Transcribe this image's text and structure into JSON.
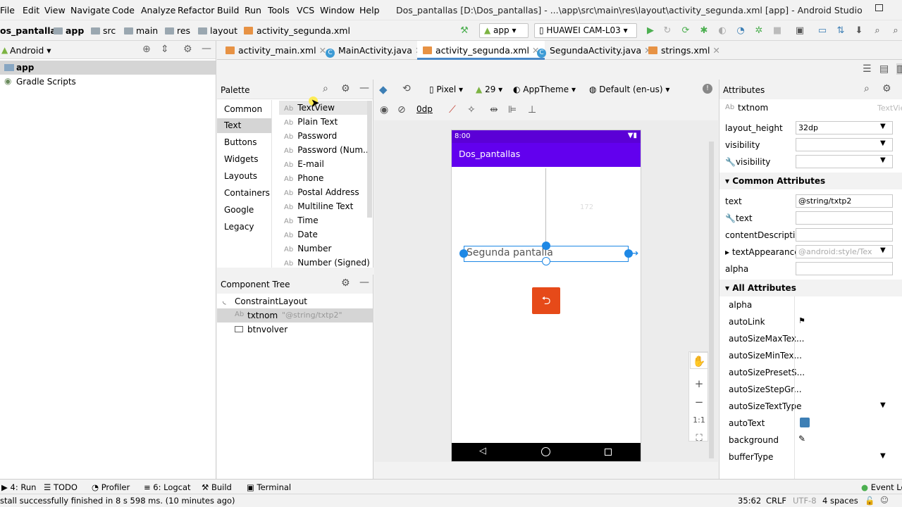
{
  "menu": [
    "File",
    "Edit",
    "View",
    "Navigate",
    "Code",
    "Analyze",
    "Refactor",
    "Build",
    "Run",
    "Tools",
    "VCS",
    "Window",
    "Help"
  ],
  "window_title": "Dos_pantallas [D:\\Dos_pantallas] - ...\\app\\src\\main\\res\\layout\\activity_segunda.xml [app] - Android Studio",
  "breadcrumb": [
    "os_pantallas",
    "app",
    "src",
    "main",
    "res",
    "layout",
    "activity_segunda.xml"
  ],
  "run_config": "app",
  "device": "HUAWEI CAM-L03",
  "project_view": "Android",
  "project_tree": [
    "app",
    "Gradle Scripts"
  ],
  "editor_tabs": [
    {
      "label": "activity_main.xml",
      "kind": "xml"
    },
    {
      "label": "MainActivity.java",
      "kind": "java"
    },
    {
      "label": "activity_segunda.xml",
      "kind": "xml",
      "active": true
    },
    {
      "label": "SegundaActivity.java",
      "kind": "java"
    },
    {
      "label": "strings.xml",
      "kind": "xml"
    }
  ],
  "palette": {
    "title": "Palette",
    "categories": [
      "Common",
      "Text",
      "Buttons",
      "Widgets",
      "Layouts",
      "Containers",
      "Google",
      "Legacy"
    ],
    "selected_category": "Text",
    "items": [
      "TextView",
      "Plain Text",
      "Password",
      "Password (Num...",
      "E-mail",
      "Phone",
      "Postal Address",
      "Multiline Text",
      "Time",
      "Date",
      "Number",
      "Number (Signed)"
    ],
    "item_prefix": "Ab"
  },
  "component_tree": {
    "title": "Component Tree",
    "root": "ConstraintLayout",
    "children": [
      {
        "name": "txtnom",
        "hint": "\"@string/txtp2\""
      },
      {
        "name": "btnvolver",
        "hint": ""
      }
    ]
  },
  "design_toolbar": {
    "device": "Pixel",
    "api": "29",
    "theme": "AppTheme",
    "locale": "Default (en-us)",
    "margin": "0dp"
  },
  "phone": {
    "time": "8:00",
    "app_title": "Dos_pantallas",
    "text": "Segunda pantalla",
    "margin_label": "172",
    "button_color": "#e64a19"
  },
  "zoom_controls": [
    "+",
    "−",
    "1:1"
  ],
  "attributes": {
    "title": "Attributes",
    "component": "txtnom",
    "component_type": "TextView",
    "top_rows": [
      {
        "name": "layout_height",
        "value": "32dp",
        "dropdown": true
      },
      {
        "name": "visibility",
        "value": "",
        "dropdown": true
      },
      {
        "name": "visibility",
        "value": "",
        "dropdown": true,
        "tool": true
      }
    ],
    "common_title": "Common Attributes",
    "common_rows": [
      {
        "name": "text",
        "value": "@string/txtp2"
      },
      {
        "name": "text",
        "value": "",
        "tool": true
      },
      {
        "name": "contentDescripti...",
        "value": ""
      },
      {
        "name": "textAppearance",
        "value": "@android:style/Tex",
        "hint": true,
        "dropdown": true
      },
      {
        "name": "alpha",
        "value": ""
      }
    ],
    "all_title": "All Attributes",
    "all_rows": [
      "alpha",
      "autoLink",
      "autoSizeMaxTex...",
      "autoSizeMinTex...",
      "autoSizePresetS...",
      "autoSizeStepGr...",
      "autoSizeTextType",
      "autoText",
      "background",
      "bufferType"
    ]
  },
  "bottom_tools": [
    {
      "label": "4: Run"
    },
    {
      "label": "TODO"
    },
    {
      "label": "Profiler"
    },
    {
      "label": "6: Logcat"
    },
    {
      "label": "Build"
    },
    {
      "label": "Terminal"
    }
  ],
  "event_log": "Event Lo",
  "status": {
    "message": "stall successfully finished in 8 s 598 ms. (10 minutes ago)",
    "position": "35:62",
    "line_sep": "CRLF",
    "encoding": "UTF-8",
    "indent": "4 spaces"
  }
}
